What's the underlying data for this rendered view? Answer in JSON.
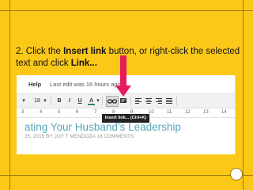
{
  "slide": {
    "step": "2. Click the",
    "bold1": "Insert link",
    "mid": "button, or right-click the selected text and click",
    "bold2": "Link..."
  },
  "screenshot": {
    "menu_help": "Help",
    "last_edit": "Last edit was 16 hours ago",
    "font_size": "18",
    "bold_label": "B",
    "italic_label": "I",
    "underline_label": "U",
    "text_color_label": "A",
    "tooltip": "Insert link... (Ctrl+K)",
    "ruler": [
      "3",
      "4",
      "5",
      "6",
      "7",
      "8",
      "9",
      "10",
      "11",
      "12",
      "13",
      "14"
    ],
    "doc_title": "ating Your Husband’s Leadership",
    "doc_meta": "25, 2015 BY JOY T MENDOZA 19 COMMENTS"
  },
  "colors": {
    "slide_background": "#fcc818",
    "arrow": "#e8195c",
    "title_link": "#58a6b8",
    "text_color_underline": "#2e8b57"
  },
  "icons": [
    "insert-link-icon",
    "insert-comment-icon",
    "align-left-icon",
    "align-center-icon",
    "align-right-icon",
    "justify-icon"
  ]
}
